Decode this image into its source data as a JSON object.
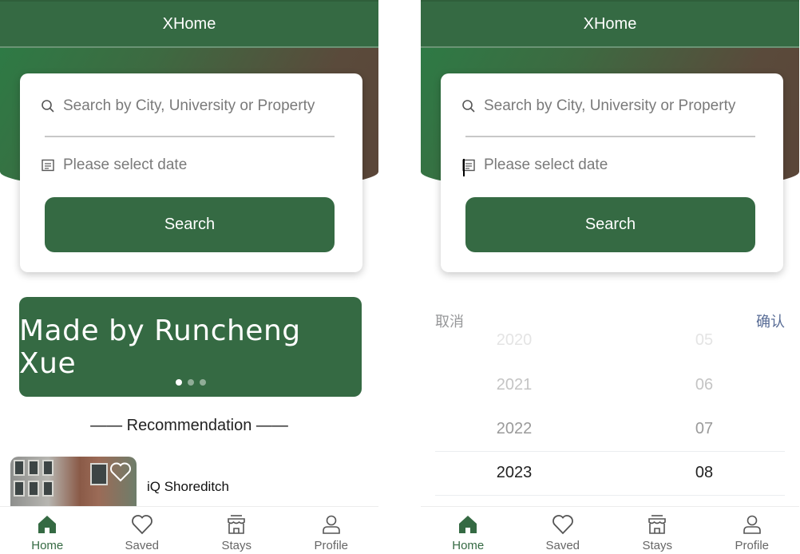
{
  "left": {
    "app_title": "XHome",
    "search": {
      "placeholder": "Search by City, University or Property",
      "date_placeholder": "Please select date",
      "button_label": "Search"
    },
    "banner": {
      "text": "Made by Runcheng Xue",
      "slides": 3,
      "active_slide": 1
    },
    "recommendation_title": "—— Recommendation ——",
    "property": {
      "name": "iQ Shoreditch",
      "icon": "heart-icon"
    },
    "tabbar": [
      {
        "label": "Home",
        "icon": "home-icon",
        "active": true
      },
      {
        "label": "Saved",
        "icon": "heart-icon",
        "active": false
      },
      {
        "label": "Stays",
        "icon": "store-icon",
        "active": false
      },
      {
        "label": "Profile",
        "icon": "user-icon",
        "active": false
      }
    ]
  },
  "right": {
    "app_title": "XHome",
    "search": {
      "placeholder": "Search by City, University or Property",
      "date_placeholder": "Please select date",
      "button_label": "Search"
    },
    "picker": {
      "cancel_label": "取消",
      "confirm_label": "确认",
      "years": [
        "2020",
        "2021",
        "2022",
        "2023"
      ],
      "months": [
        "05",
        "06",
        "07",
        "08"
      ],
      "selected_year": "2023",
      "selected_month": "08"
    },
    "tabbar": [
      {
        "label": "Home",
        "icon": "home-icon",
        "active": true
      },
      {
        "label": "Saved",
        "icon": "heart-icon",
        "active": false
      },
      {
        "label": "Stays",
        "icon": "store-icon",
        "active": false
      },
      {
        "label": "Profile",
        "icon": "user-icon",
        "active": false
      }
    ]
  },
  "colors": {
    "primary": "#356a43",
    "hero_end": "#5a4538",
    "placeholder": "#7a7a7a",
    "picker_confirm": "#576b95",
    "picker_cancel": "#969799"
  }
}
